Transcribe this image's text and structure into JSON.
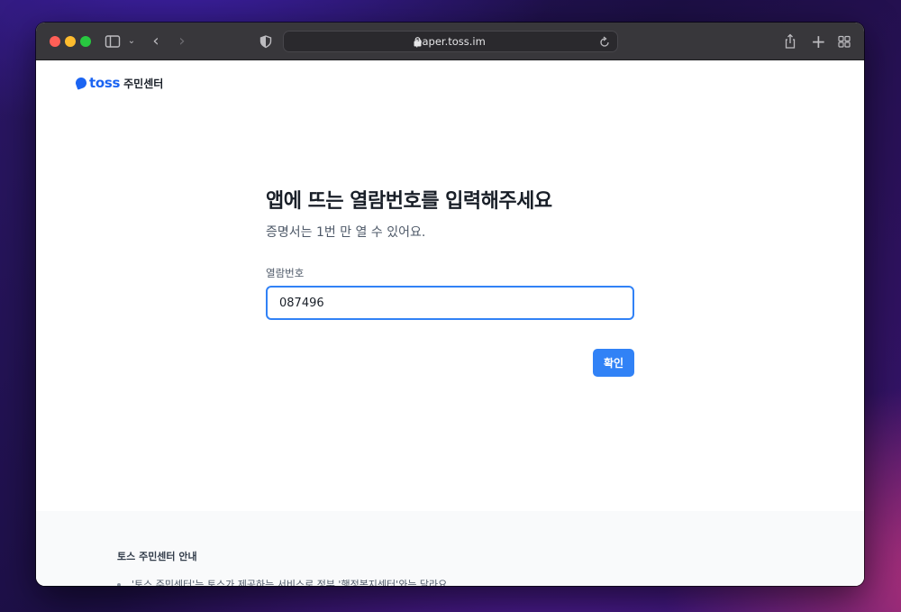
{
  "browser": {
    "url": "paper.toss.im"
  },
  "brand": {
    "wordmark": "toss",
    "subtitle": "주민센터",
    "color": "#1b64f2"
  },
  "form": {
    "headline": "앱에 뜨는 열람번호를 입력해주세요",
    "subline": "증명서는 1번 만 열 수 있어요.",
    "field_label": "열람번호",
    "field_value": "087496",
    "confirm_label": "확인",
    "accent_color": "#3182f6"
  },
  "footer": {
    "title": "토스 주민센터 안내",
    "item_1": "'토스 주민센터'는 토스가 제공하는 서비스로 정부 '행정복지센터'와는 달라요."
  }
}
